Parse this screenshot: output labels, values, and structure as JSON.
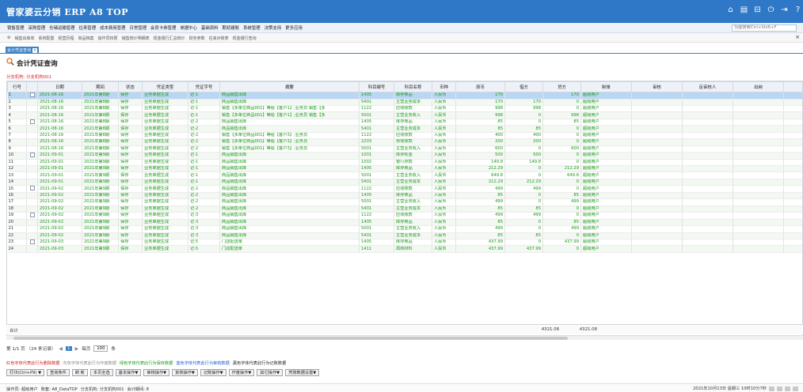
{
  "app": {
    "title": "管家婆云分销 ERP A8 TOP",
    "icons": [
      "home-icon",
      "calendar-icon",
      "lock-icon",
      "power-icon",
      "exit-icon",
      "help-icon"
    ]
  },
  "menu": {
    "items": [
      "销售管理",
      "采购管理",
      "仓储运输管理",
      "往来管理",
      "成本费用管理",
      "日常管理",
      "会员卡券管理",
      "单据中心",
      "基础资料",
      "期初建账",
      "系统管理",
      "决策支持",
      "更多应用"
    ],
    "search_placeholder": "功能搜索Ctrl+Shift+F"
  },
  "quickbar": {
    "items": [
      "销售出库单",
      "系统配置",
      "经营历程",
      "商品档案",
      "操作员权限",
      "销售统计明细表",
      "现金银行汇总统计",
      "财务参数",
      "往来对账表",
      "现金银行查询"
    ]
  },
  "tab": {
    "label": "会计凭证查询"
  },
  "page": {
    "title": "会计凭证查询",
    "org_label": "分支机构:",
    "org_value": "分支机构001"
  },
  "table": {
    "headers": [
      "行号",
      "",
      "日期",
      "期间",
      "状态",
      "凭证类型",
      "凭证字号",
      "摘要",
      "科目编号",
      "科目名称",
      "币种",
      "原币",
      "借方",
      "贷方",
      "制单",
      "审核",
      "反审核人",
      "出纳",
      "复核"
    ],
    "rows": [
      [
        "1",
        "cb",
        "2021-08-16",
        "2021年第8期",
        "保存",
        "业务单据生成",
        "记-1",
        "商品销售出库",
        "1405",
        "库存商品",
        "人民币",
        "170",
        "",
        "170",
        "超级用户",
        "",
        "",
        "",
        ""
      ],
      [
        "2",
        "",
        "2021-08-16",
        "2021年第8期",
        "保存",
        "业务单据生成",
        "记-1",
        "商品销售出库",
        "5401",
        "主营业务成本",
        "人民币",
        "170",
        "170",
        "0",
        "超级用户",
        "",
        "",
        "",
        ""
      ],
      [
        "3",
        "",
        "2021-08-16",
        "2021年第8期",
        "保存",
        "业务单据生成",
        "记-1",
        "销售【多单位商品001】等给【客户1】;业务员 销售【多",
        "1122",
        "应收账款",
        "人民币",
        "998",
        "998",
        "0",
        "超级用户",
        "",
        "",
        "",
        ""
      ],
      [
        "4",
        "",
        "2021-08-16",
        "2021年第8期",
        "保存",
        "业务单据生成",
        "记-1",
        "销售【多单位商品001】等给【客户1】;业务员 销售【多",
        "5001",
        "主营业务收入",
        "人民币",
        "998",
        "0",
        "998",
        "超级用户",
        "",
        "",
        "",
        ""
      ],
      [
        "5",
        "cb",
        "2021-08-16",
        "2021年第8期",
        "保存",
        "业务单据生成",
        "记-2",
        "商品销售出库",
        "1405",
        "库存商品",
        "人民币",
        "85",
        "0",
        "85",
        "超级用户",
        "",
        "",
        "",
        ""
      ],
      [
        "6",
        "",
        "2021-08-16",
        "2021年第8期",
        "保存",
        "业务单据生成",
        "记-2",
        "商品销售出库",
        "5401",
        "主营业务成本",
        "人民币",
        "85",
        "85",
        "0",
        "超级用户",
        "",
        "",
        "",
        ""
      ],
      [
        "7",
        "",
        "2021-08-16",
        "2021年第8期",
        "保存",
        "业务单据生成",
        "记-2",
        "销售【多单位商品001】等给【客户3】;业务员",
        "1122",
        "应收账款",
        "人民币",
        "400",
        "400",
        "0",
        "超级用户",
        "",
        "",
        "",
        ""
      ],
      [
        "8",
        "",
        "2021-08-16",
        "2021年第8期",
        "保存",
        "业务单据生成",
        "记-2",
        "销售【多单位商品001】等给【客户3】;业务员",
        "2203",
        "预收账款",
        "人民币",
        "200",
        "200",
        "0",
        "超级用户",
        "",
        "",
        "",
        ""
      ],
      [
        "9",
        "",
        "2021-08-16",
        "2021年第8期",
        "保存",
        "业务单据生成",
        "记-2",
        "销售【多单位商品001】等给【客户3】;业务员",
        "5001",
        "主营业务收入",
        "人民币",
        "600",
        "0",
        "600",
        "超级用户",
        "",
        "",
        "",
        ""
      ],
      [
        "10",
        "cb",
        "2021-09-01",
        "2021年第9期",
        "保存",
        "业务单据生成",
        "记-1",
        "商品销售出库",
        "1001",
        "库存现金",
        "人民币",
        "500",
        "500",
        "0",
        "超级用户",
        "",
        "",
        "",
        ""
      ],
      [
        "11",
        "",
        "2021-09-01",
        "2021年第9期",
        "保存",
        "业务单据生成",
        "记-1",
        "商品销售出库",
        "1002",
        "银行存款",
        "人民币",
        "149.8",
        "149.8",
        "0",
        "超级用户",
        "",
        "",
        "",
        ""
      ],
      [
        "12",
        "",
        "2021-09-01",
        "2021年第9期",
        "保存",
        "业务单据生成",
        "记-1",
        "商品销售出库",
        "1405",
        "库存商品",
        "人民币",
        "212.29",
        "0",
        "212.29",
        "超级用户",
        "",
        "",
        "",
        ""
      ],
      [
        "13",
        "",
        "2021-09-01",
        "2021年第9期",
        "保存",
        "业务单据生成",
        "记-1",
        "商品销售出库",
        "5001",
        "主营业务收入",
        "人民币",
        "649.8",
        "0",
        "649.8",
        "超级用户",
        "",
        "",
        "",
        ""
      ],
      [
        "14",
        "",
        "2021-09-01",
        "2021年第9期",
        "保存",
        "业务单据生成",
        "记-1",
        "商品销售出库",
        "5401",
        "主营业务成本",
        "人民币",
        "212.29",
        "212.29",
        "0",
        "超级用户",
        "",
        "",
        "",
        ""
      ],
      [
        "15",
        "cb",
        "2021-09-02",
        "2021年第9期",
        "保存",
        "业务单据生成",
        "记-2",
        "商品销售出库",
        "1122",
        "应收账款",
        "人民币",
        "499",
        "499",
        "0",
        "超级用户",
        "",
        "",
        "",
        ""
      ],
      [
        "16",
        "",
        "2021-09-02",
        "2021年第9期",
        "保存",
        "业务单据生成",
        "记-2",
        "商品销售出库",
        "1405",
        "库存商品",
        "人民币",
        "85",
        "0",
        "85",
        "超级用户",
        "",
        "",
        "",
        ""
      ],
      [
        "17",
        "",
        "2021-09-02",
        "2021年第9期",
        "保存",
        "业务单据生成",
        "记-2",
        "商品销售出库",
        "5001",
        "主营业务收入",
        "人民币",
        "499",
        "0",
        "499",
        "超级用户",
        "",
        "",
        "",
        ""
      ],
      [
        "18",
        "",
        "2021-09-02",
        "2021年第9期",
        "保存",
        "业务单据生成",
        "记-2",
        "商品销售出库",
        "5401",
        "主营业务成本",
        "人民币",
        "85",
        "85",
        "0",
        "超级用户",
        "",
        "",
        "",
        ""
      ],
      [
        "19",
        "cb",
        "2021-09-02",
        "2021年第9期",
        "保存",
        "业务单据生成",
        "记-3",
        "商品销售出库",
        "1122",
        "应收账款",
        "人民币",
        "499",
        "499",
        "0",
        "超级用户",
        "",
        "",
        "",
        ""
      ],
      [
        "20",
        "",
        "2021-09-02",
        "2021年第9期",
        "保存",
        "业务单据生成",
        "记-3",
        "商品销售出库",
        "1405",
        "库存商品",
        "人民币",
        "85",
        "0",
        "85",
        "超级用户",
        "",
        "",
        "",
        ""
      ],
      [
        "21",
        "",
        "2021-09-02",
        "2021年第9期",
        "保存",
        "业务单据生成",
        "记-3",
        "商品销售出库",
        "5001",
        "主营业务收入",
        "人民币",
        "499",
        "0",
        "499",
        "超级用户",
        "",
        "",
        "",
        ""
      ],
      [
        "22",
        "",
        "2021-09-02",
        "2021年第9期",
        "保存",
        "业务单据生成",
        "记-3",
        "商品销售出库",
        "5401",
        "主营业务成本",
        "人民币",
        "85",
        "85",
        "0",
        "超级用户",
        "",
        "",
        "",
        ""
      ],
      [
        "23",
        "cb",
        "2021-09-03",
        "2021年第9期",
        "保存",
        "业务单据生成",
        "记-5",
        "门店配送单",
        "1405",
        "库存商品",
        "人民币",
        "437.99",
        "0",
        "437.99",
        "超级用户",
        "",
        "",
        "",
        ""
      ],
      [
        "24",
        "",
        "2021-09-03",
        "2021年第9期",
        "保存",
        "业务单据生成",
        "记-5",
        "门店配送单",
        "1411",
        "周转材料",
        "人民币",
        "437.99",
        "437.99",
        "0",
        "超级用户",
        "",
        "",
        "",
        ""
      ]
    ],
    "selected_row": 0
  },
  "totals": {
    "label": "合计",
    "debit": "4321.08",
    "credit": "4321.08"
  },
  "pager": {
    "info": "第 1/1 页 （24 条记录）",
    "prev": "◀",
    "current": "1",
    "next": "▶",
    "per_page_label": "每页",
    "per_page": "100",
    "unit": "条"
  },
  "legend": [
    {
      "text": "红色字体代表此行为删除数据",
      "color": "#d32020"
    },
    {
      "text": "灰色字体代表此行为作废数据",
      "color": "#8a8a8a"
    },
    {
      "text": "绿色字体代表此行为保存数据",
      "color": "#1a9a1a"
    },
    {
      "text": "蓝色字体代表此行为审核数据",
      "color": "#2060d0"
    },
    {
      "text": "黑色字体代表此行为记账数据",
      "color": "#222222"
    }
  ],
  "actions": [
    "打印(Ctrl+P9) ▼",
    "查询条件",
    "刷 新",
    "本页全选",
    "基本操作▼",
    "审核操作▼",
    "复核操作▼",
    "记账操作▼",
    "作废操作▼",
    "其它操作▼",
    "凭账数据设置▼"
  ],
  "status": {
    "items": [
      "操作员: 超级用户",
      "账套: A8_DataTOP",
      "分支机构: 分支机构001",
      "会计期间: 8"
    ],
    "datetime": "2021年10月13日 星期三 10时10分7秒"
  },
  "colors": {
    "header_blue": "#2f78c8",
    "saved_green": "#1a9a1a",
    "selected_row": "#b9d6f3"
  }
}
